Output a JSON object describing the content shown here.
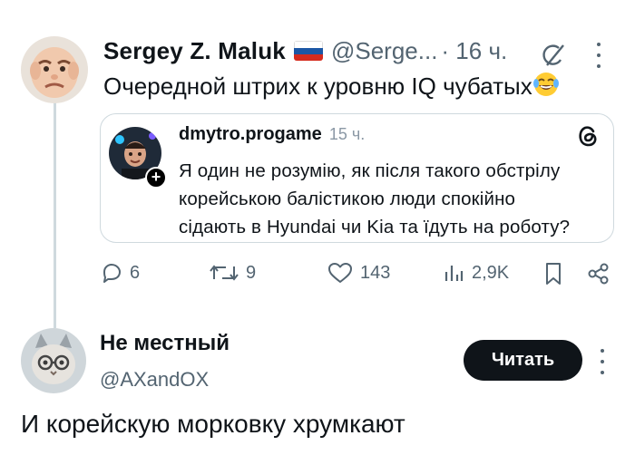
{
  "tweet": {
    "author_name": "Sergey Z. Maluk",
    "flag_colors": [
      "#ffffff",
      "#1c57a5",
      "#d52b1e"
    ],
    "handle": "@Serge...",
    "time": "· 16 ч.",
    "text": "Очередной штрих к уровню IQ чубатых",
    "emoji_icon": "laughing-tears-emoji"
  },
  "quote": {
    "author_name": "dmytro.progame",
    "time": "15 ч.",
    "source_icon": "threads-logo",
    "plus": "+",
    "text_lines": [
      "Я один не розумію, як після такого обстрілу",
      "корейською балістикою люди спокійно",
      "сідають в Hyundai чи Kia та їдуть на роботу?"
    ]
  },
  "actions": {
    "replies": "6",
    "reposts": "9",
    "likes": "143",
    "views": "2,9K"
  },
  "reply": {
    "author_name": "Не местный",
    "handle": "@AXandOX",
    "follow_label": "Читать",
    "text": "И корейскую морковку хрумкают"
  },
  "colors": {
    "text": "#0f1419",
    "secondary": "#536471",
    "border": "#cfd9de",
    "button_bg": "#0f1419"
  }
}
